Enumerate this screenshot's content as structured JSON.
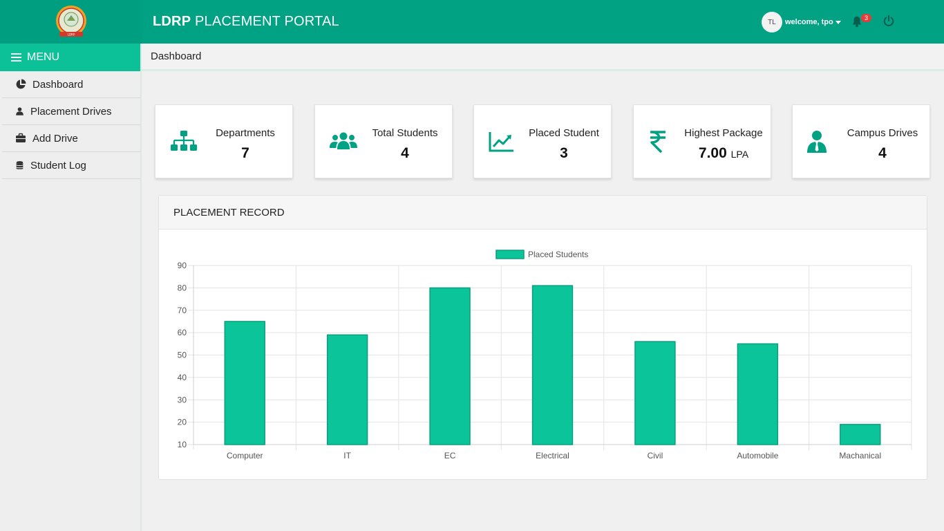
{
  "header": {
    "brand_bold": "LDRP",
    "brand_rest": " PLACEMENT PORTAL",
    "avatar_initials": "TL",
    "welcome": "welcome, tpo",
    "notification_count": "3",
    "logo_icon": "college-emblem",
    "bell_icon": "bell-icon",
    "power_icon": "power-icon"
  },
  "sidebar": {
    "menu_label": "MENU",
    "items": [
      {
        "label": "Dashboard",
        "icon": "pie-chart-icon"
      },
      {
        "label": "Placement Drives",
        "icon": "user-icon"
      },
      {
        "label": "Add Drive",
        "icon": "briefcase-icon"
      },
      {
        "label": "Student Log",
        "icon": "database-icon"
      }
    ]
  },
  "breadcrumb": "Dashboard",
  "cards": [
    {
      "title": "Departments",
      "value": "7",
      "unit": "",
      "icon": "sitemap-icon"
    },
    {
      "title": "Total Students",
      "value": "4",
      "unit": "",
      "icon": "users-icon"
    },
    {
      "title": "Placed Student",
      "value": "3",
      "unit": "",
      "icon": "chart-line-icon"
    },
    {
      "title": "Highest Package",
      "value": "7.00",
      "unit": "LPA",
      "icon": "rupee-icon"
    },
    {
      "title": "Campus Drives",
      "value": "4",
      "unit": "",
      "icon": "user-tie-icon"
    }
  ],
  "colors": {
    "header": "#00a283",
    "accent": "#0cc197",
    "bar_fill": "#0cc49a",
    "bar_stroke": "#08a07c",
    "icon": "#00a283"
  },
  "panel": {
    "title": "PLACEMENT RECORD"
  },
  "chart_data": {
    "type": "bar",
    "categories": [
      "Computer",
      "IT",
      "EC",
      "Electrical",
      "Civil",
      "Automobile",
      "Machanical"
    ],
    "series": [
      {
        "name": "Placed Students",
        "values": [
          65,
          59,
          80,
          81,
          56,
          55,
          19
        ]
      }
    ],
    "ylim": [
      10,
      90
    ],
    "yticks": [
      10,
      20,
      30,
      40,
      50,
      60,
      70,
      80,
      90
    ],
    "grid": true,
    "legend": "top-center"
  }
}
